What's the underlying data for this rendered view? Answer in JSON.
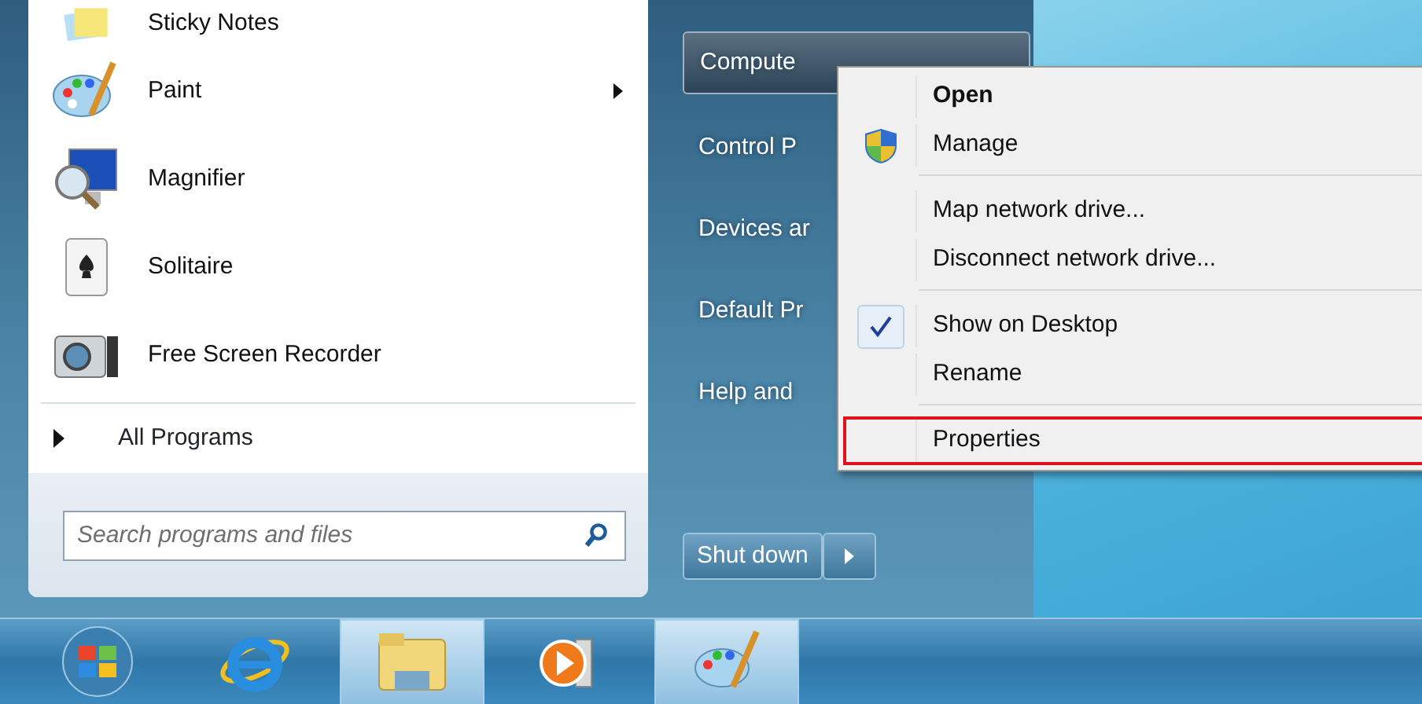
{
  "start_menu": {
    "programs": [
      {
        "label": "Sticky Notes",
        "kind": "notes",
        "submenu": false
      },
      {
        "label": "Paint",
        "kind": "paint",
        "submenu": true
      },
      {
        "label": "Magnifier",
        "kind": "magnifier",
        "submenu": false
      },
      {
        "label": "Solitaire",
        "kind": "cards",
        "submenu": false
      },
      {
        "label": "Free Screen Recorder",
        "kind": "camera",
        "submenu": false
      }
    ],
    "all_programs": "All Programs",
    "search": {
      "placeholder": "Search programs and files"
    },
    "places": [
      {
        "label": "Compute",
        "selected": true
      },
      {
        "label": "Control P",
        "selected": false
      },
      {
        "label": "Devices ar",
        "selected": false
      },
      {
        "label": "Default Pr",
        "selected": false
      },
      {
        "label": "Help and",
        "selected": false
      }
    ],
    "shut_down": "Shut down"
  },
  "context_menu": [
    {
      "kind": "item",
      "label": "Open",
      "bold": true,
      "shield": false,
      "checked": false,
      "selected": false
    },
    {
      "kind": "item",
      "label": "Manage",
      "bold": false,
      "shield": true,
      "checked": false,
      "selected": false
    },
    {
      "kind": "separator"
    },
    {
      "kind": "item",
      "label": "Map network drive...",
      "bold": false,
      "shield": false,
      "checked": false,
      "selected": false
    },
    {
      "kind": "item",
      "label": "Disconnect network drive...",
      "bold": false,
      "shield": false,
      "checked": false,
      "selected": false
    },
    {
      "kind": "separator"
    },
    {
      "kind": "item",
      "label": "Show on Desktop",
      "bold": false,
      "shield": false,
      "checked": true,
      "selected": false
    },
    {
      "kind": "item",
      "label": "Rename",
      "bold": false,
      "shield": false,
      "checked": false,
      "selected": false
    },
    {
      "kind": "separator"
    },
    {
      "kind": "item",
      "label": "Properties",
      "bold": false,
      "shield": false,
      "checked": false,
      "selected": true
    }
  ],
  "taskbar": [
    {
      "kind": "start",
      "running": false
    },
    {
      "kind": "browser",
      "running": false
    },
    {
      "kind": "folder",
      "running": true
    },
    {
      "kind": "media",
      "running": false
    },
    {
      "kind": "paint",
      "running": true
    }
  ]
}
